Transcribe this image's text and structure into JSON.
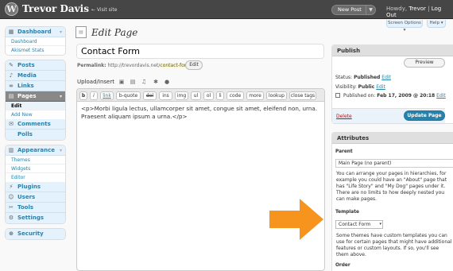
{
  "header": {
    "logo_glyph": "W",
    "site_title": "Trevor Davis",
    "visit_site": "← Visit site",
    "new_post": "New Post",
    "howdy_prefix": "Howdy,",
    "user": "Trevor",
    "separator": "|",
    "logout": "Log Out"
  },
  "screen_options": {
    "screen_options": "Screen Options ▾",
    "help": "Help ▾"
  },
  "sidebar": {
    "dashboard": {
      "label": "Dashboard",
      "items": [
        "Dashboard",
        "Akismet Stats"
      ]
    },
    "posts": "Posts",
    "media": "Media",
    "links": "Links",
    "pages": {
      "label": "Pages",
      "items": [
        "Edit",
        "Add New"
      ]
    },
    "comments": "Comments",
    "polls": "Polls",
    "appearance": {
      "label": "Appearance",
      "items": [
        "Themes",
        "Widgets",
        "Editor"
      ]
    },
    "plugins": "Plugins",
    "users": "Users",
    "tools": "Tools",
    "settings": "Settings",
    "security": "Security"
  },
  "main": {
    "page_title": "Edit Page",
    "title_value": "Contact Form",
    "permalink_label": "Permalink:",
    "permalink_url": "http://trevordavis.net/",
    "permalink_slug": "contact-form",
    "permalink_end": "/",
    "edit_label": "Edit",
    "upload_insert": "Upload/Insert",
    "quicktags": [
      "b",
      "i",
      "link",
      "b-quote",
      "del",
      "ins",
      "img",
      "ul",
      "ol",
      "li",
      "code",
      "more",
      "lookup",
      "close tags"
    ],
    "content": "<p>Morbi ligula lectus, ullamcorper sit amet, congue sit amet, eleifend non, urna. Praesent aliquam ipsum a urna.</p>"
  },
  "publish": {
    "heading": "Publish",
    "preview": "Preview",
    "status_label": "Status:",
    "status_value": "Published",
    "status_edit": "Edit",
    "visibility_label": "Visibility:",
    "visibility_value": "Public",
    "visibility_edit": "Edit",
    "published_on_label": "Published on:",
    "published_on_value": "Feb 17, 2009 @ 20:18",
    "published_edit": "Edit",
    "delete": "Delete",
    "update": "Update Page"
  },
  "attributes": {
    "heading": "Attributes",
    "parent_label": "Parent",
    "parent_value": "Main Page (no parent)",
    "parent_help": "You can arrange your pages in hierarchies, for example you could have an \"About\" page that has \"Life Story\" and \"My Dog\" pages under it. There are no limits to how deeply nested you can make pages.",
    "template_label": "Template",
    "template_value": "Contact Form",
    "template_help": "Some themes have custom templates you can use for certain pages that might have additional features or custom layouts. If so, you'll see them above.",
    "order_label": "Order"
  },
  "colors": {
    "arrow": "#f7941d",
    "link": "#2583ad",
    "update_button": "#2583ad",
    "header": "#464646"
  }
}
